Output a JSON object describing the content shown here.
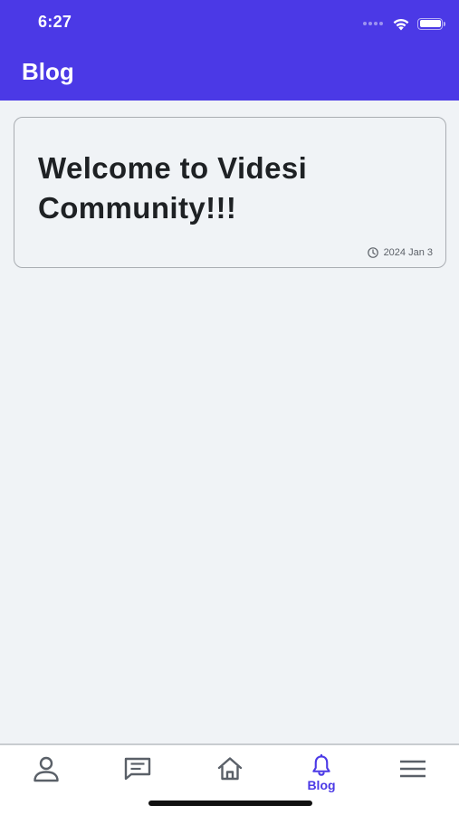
{
  "status_bar": {
    "time": "6:27"
  },
  "header": {
    "title": "Blog",
    "background_color": "#4b39e6"
  },
  "posts": [
    {
      "title": "Welcome to Videsi Community!!!",
      "date": "2024 Jan 3",
      "icon": "clock-icon"
    }
  ],
  "tabbar": {
    "active_color": "#4b39e6",
    "inactive_color": "#5a6068",
    "tabs": [
      {
        "icon": "person-icon",
        "label": ""
      },
      {
        "icon": "chat-icon",
        "label": ""
      },
      {
        "icon": "home-icon",
        "label": ""
      },
      {
        "icon": "bell-icon",
        "label": "Blog",
        "active": true
      },
      {
        "icon": "menu-icon",
        "label": ""
      }
    ]
  }
}
